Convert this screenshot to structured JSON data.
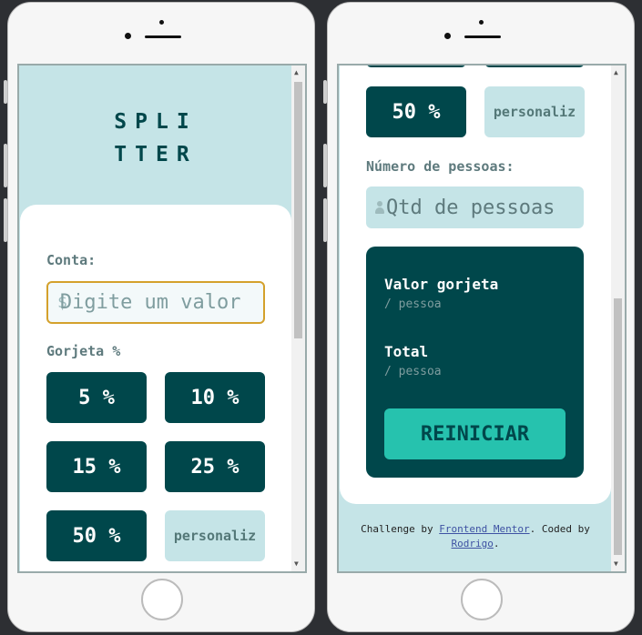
{
  "left_screen": {
    "logo": "SPLI\nTTER",
    "bill_label": "Conta:",
    "bill_placeholder": "Digite um valor",
    "tip_label": "Gorjeta %",
    "tips": [
      "5 %",
      "10 %",
      "15 %",
      "25 %",
      "50 %"
    ],
    "custom_tip": "personaliz"
  },
  "right_screen": {
    "tip_50": "50 %",
    "custom_tip": "personaliz",
    "people_label": "Número de pessoas:",
    "people_placeholder": "Qtd de pessoas",
    "tip_amount_label": "Valor gorjeta",
    "tip_amount_sub": "/ pessoa",
    "total_label": "Total",
    "total_sub": "/ pessoa",
    "reset_label": "REINICIAR",
    "footer": {
      "prefix": "Challenge by ",
      "link1": "Frontend Mentor",
      "middle": ". Coded by",
      "link2": "Rodrigo",
      "suffix": "."
    }
  },
  "colors": {
    "accent_dark": "#00474b",
    "accent_light": "#c5e4e7",
    "reset_button": "#26c2ae",
    "focus_border": "#d4a12c"
  }
}
